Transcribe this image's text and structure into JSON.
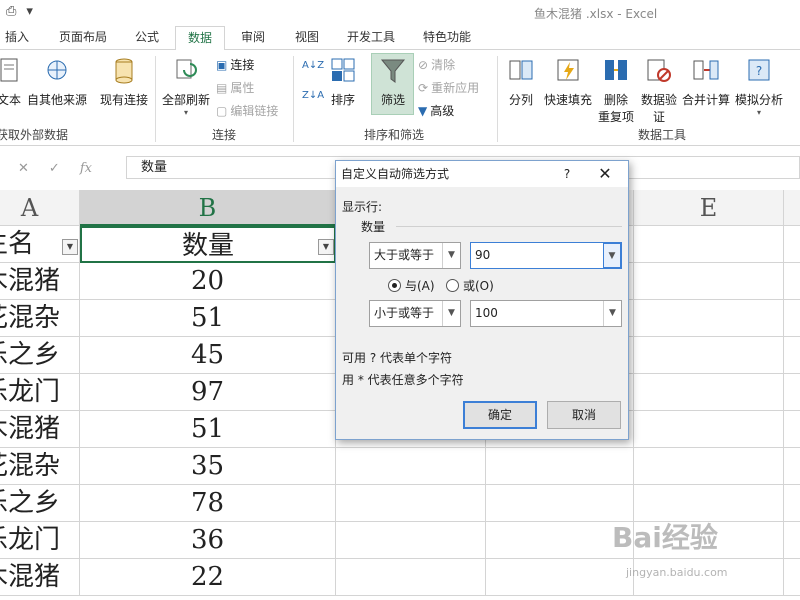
{
  "titlebar": {
    "title": "鱼木混猪 .xlsx - Excel"
  },
  "tabs": [
    {
      "label": "插入"
    },
    {
      "label": "页面布局"
    },
    {
      "label": "公式"
    },
    {
      "label": "数据"
    },
    {
      "label": "审阅"
    },
    {
      "label": "视图"
    },
    {
      "label": "开发工具"
    },
    {
      "label": "特色功能"
    }
  ],
  "ribbon": {
    "get_external": {
      "text_label": "文本",
      "other_label": "自其他来源",
      "group": "获取外部数据",
      "existing_label": "现有连接"
    },
    "connections": {
      "refresh_label": "全部刷新",
      "conn_label": "连接",
      "prop_label": "属性",
      "edit_label": "编辑链接",
      "group": "连接"
    },
    "sort_filter": {
      "sort_label": "排序",
      "filter_label": "筛选",
      "clear_label": "清除",
      "reapply_label": "重新应用",
      "advanced_label": "高级",
      "group": "排序和筛选"
    },
    "data_tools": {
      "split_label": "分列",
      "flash_label": "快速填充",
      "dup_label_1": "删除",
      "dup_label_2": "重复项",
      "valid_label_1": "数据验",
      "valid_label_2": "证",
      "consol_label": "合并计算",
      "whatif_label": "模拟分析",
      "group": "数据工具"
    }
  },
  "formula_bar": {
    "cancel": "✕",
    "enter": "✓",
    "fx": "fx",
    "value": "数量"
  },
  "columns": {
    "a": "A",
    "b": "B",
    "e": "E"
  },
  "table": {
    "header": {
      "name": "生名",
      "qty": "数量"
    },
    "rows": [
      {
        "name": "木混猪",
        "qty": "20"
      },
      {
        "name": "花混杂",
        "qty": "51"
      },
      {
        "name": "乐之乡",
        "qty": "45"
      },
      {
        "name": "乐龙门",
        "qty": "97"
      },
      {
        "name": "木混猪",
        "qty": "51"
      },
      {
        "name": "花混杂",
        "qty": "35"
      },
      {
        "name": "乐之乡",
        "qty": "78"
      },
      {
        "name": "乐龙门",
        "qty": "36"
      },
      {
        "name": "木混猪",
        "qty": "22"
      }
    ]
  },
  "dialog": {
    "title": "自定义自动筛选方式",
    "help": "?",
    "close": "✕",
    "show_rows": "显示行:",
    "field": "数量",
    "cond1_op": "大于或等于",
    "cond1_value": "90",
    "and_label": "与(A)",
    "or_label": "或(O)",
    "and_selected": true,
    "cond2_op": "小于或等于",
    "cond2_value": "100",
    "hint1": "可用 ? 代表单个字符",
    "hint2": "用 * 代表任意多个字符",
    "ok": "确定",
    "cancel": "取消"
  },
  "watermark": {
    "text": "Bai经验",
    "url": "jingyan.baidu.com"
  },
  "colors": {
    "accent": "#217346",
    "filter_active": "#cfe3d6"
  }
}
